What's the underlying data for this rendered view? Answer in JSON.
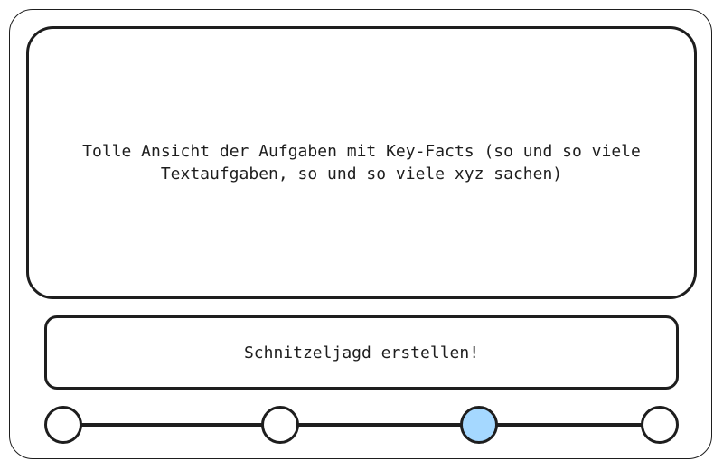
{
  "overview": {
    "text": "Tolle Ansicht der Aufgaben mit Key-Facts (so und so viele Textaufgaben, so und so viele xyz sachen)"
  },
  "create_button": {
    "label": "Schnitzeljagd erstellen!"
  },
  "stepper": {
    "steps": 4,
    "active_step": 3,
    "active_color": "#a5d8ff"
  }
}
